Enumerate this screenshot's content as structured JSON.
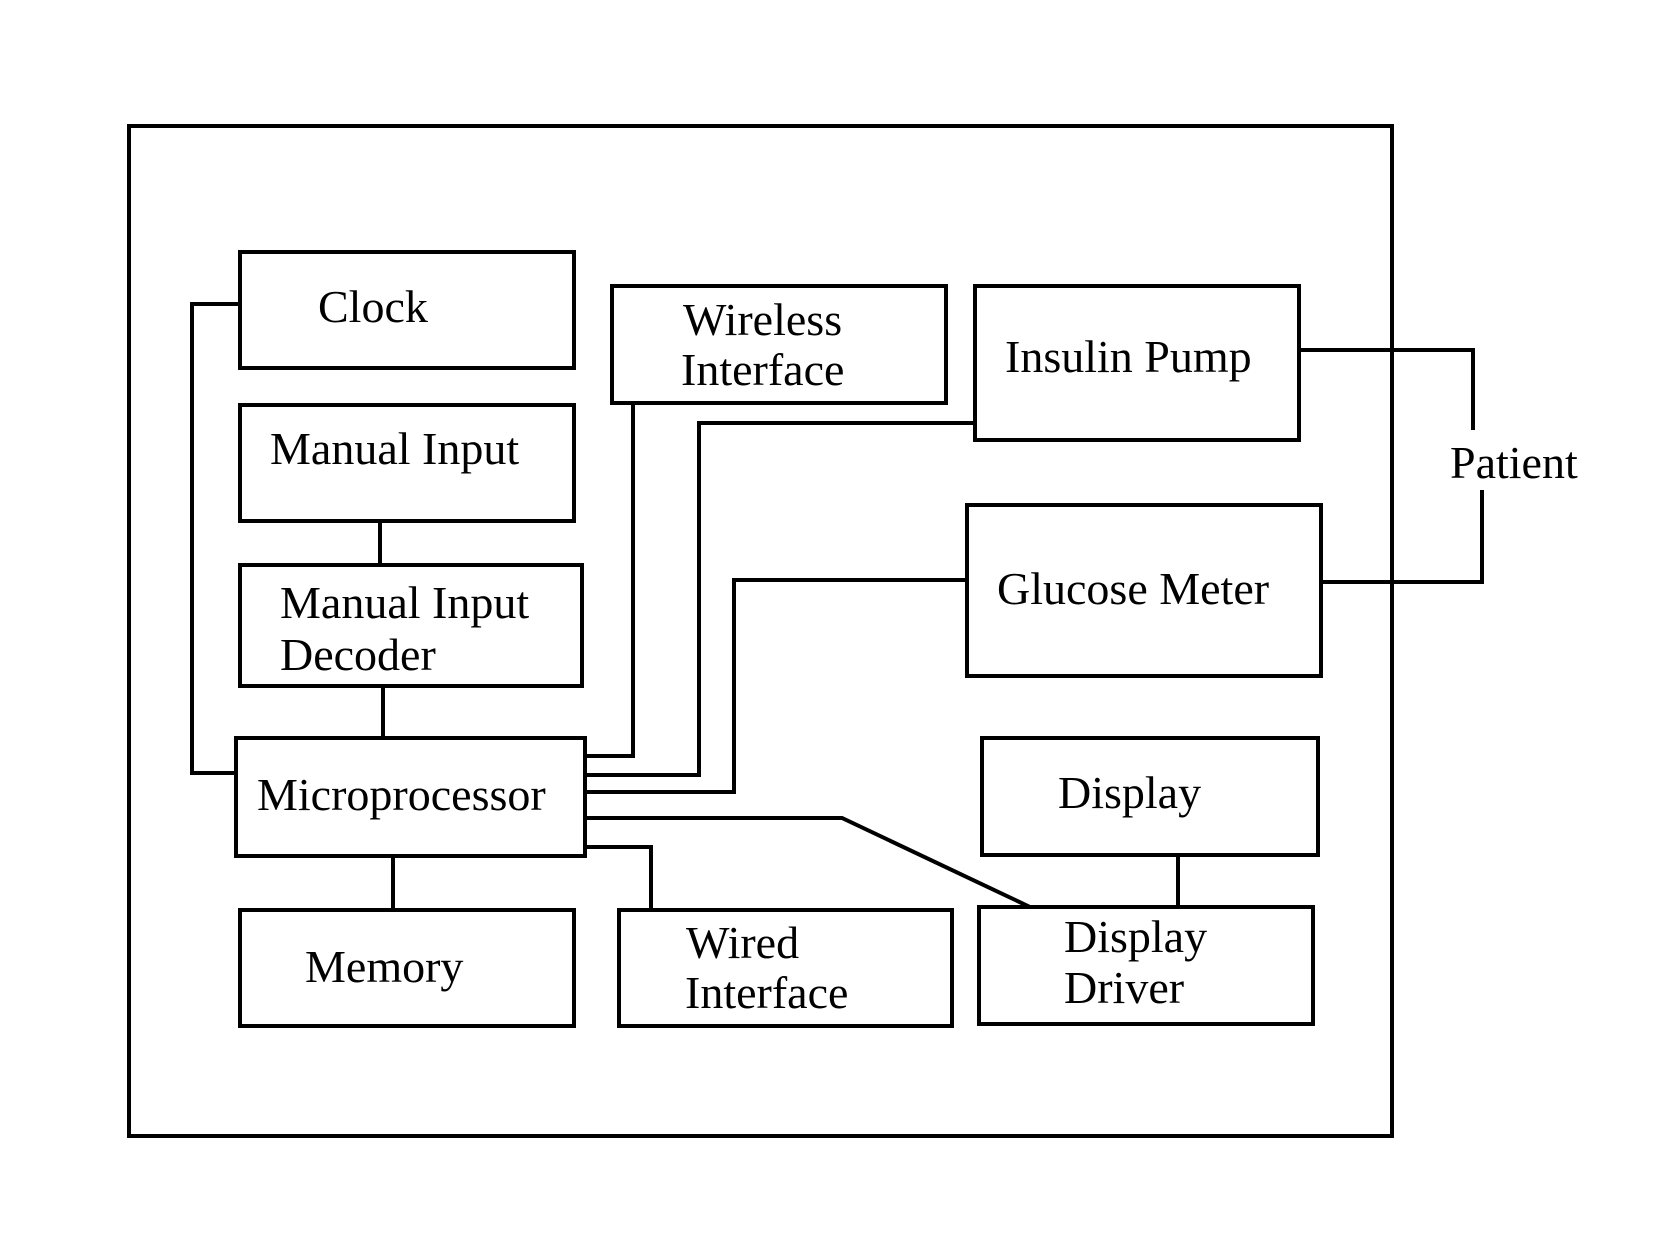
{
  "diagram": {
    "type": "block-diagram",
    "enclosure": {
      "label": ""
    },
    "blocks": {
      "clock": {
        "lines": [
          "Clock"
        ]
      },
      "manual_input": {
        "lines": [
          "Manual Input"
        ]
      },
      "manual_input_decoder": {
        "lines": [
          "Manual Input",
          "Decoder"
        ]
      },
      "microprocessor": {
        "lines": [
          "Microprocessor"
        ]
      },
      "memory": {
        "lines": [
          "Memory"
        ]
      },
      "wireless_interface": {
        "lines": [
          "Wireless",
          "Interface"
        ]
      },
      "wired_interface": {
        "lines": [
          "Wired",
          "Interface"
        ]
      },
      "insulin_pump": {
        "lines": [
          "Insulin Pump"
        ]
      },
      "glucose_meter": {
        "lines": [
          "Glucose Meter"
        ]
      },
      "display": {
        "lines": [
          "Display"
        ]
      },
      "display_driver": {
        "lines": [
          "Display",
          "Driver"
        ]
      }
    },
    "external": {
      "patient": {
        "label": "Patient"
      }
    },
    "connections": [
      {
        "from": "Clock",
        "to": "Microprocessor"
      },
      {
        "from": "Manual Input",
        "to": "Manual Input Decoder"
      },
      {
        "from": "Manual Input Decoder",
        "to": "Microprocessor"
      },
      {
        "from": "Microprocessor",
        "to": "Wireless Interface"
      },
      {
        "from": "Microprocessor",
        "to": "Insulin Pump"
      },
      {
        "from": "Microprocessor",
        "to": "Glucose Meter"
      },
      {
        "from": "Microprocessor",
        "to": "Display Driver"
      },
      {
        "from": "Microprocessor",
        "to": "Wired Interface"
      },
      {
        "from": "Microprocessor",
        "to": "Memory"
      },
      {
        "from": "Display",
        "to": "Display Driver"
      },
      {
        "from": "Insulin Pump",
        "to": "Patient"
      },
      {
        "from": "Glucose Meter",
        "to": "Patient"
      }
    ]
  }
}
